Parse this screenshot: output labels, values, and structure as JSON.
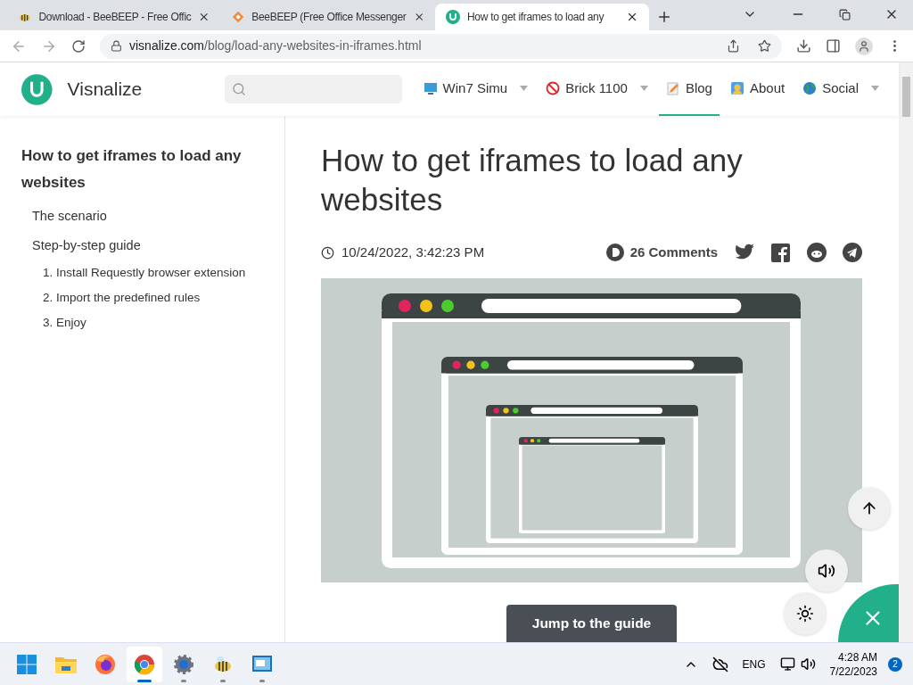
{
  "browser": {
    "tabs": [
      {
        "title": "Download - BeeBEEP - Free Offic",
        "selected": false
      },
      {
        "title": "BeeBEEP (Free Office Messenger",
        "selected": false
      },
      {
        "title": "How to get iframes to load any",
        "selected": true
      }
    ],
    "url_host": "visnalize.com",
    "url_path": "/blog/load-any-websites-in-iframes.html"
  },
  "site": {
    "logo_text": "Visnalize",
    "menu": [
      {
        "label": "Win7 Simu",
        "has_dropdown": true,
        "selected": false
      },
      {
        "label": "Brick 1100",
        "has_dropdown": true,
        "selected": false
      },
      {
        "label": "Blog",
        "has_dropdown": false,
        "selected": true
      },
      {
        "label": "About",
        "has_dropdown": false,
        "selected": false
      },
      {
        "label": "Social",
        "has_dropdown": true,
        "selected": false
      }
    ]
  },
  "toc": {
    "title": "How to get iframes to load any websites",
    "items": [
      {
        "label": "The scenario"
      },
      {
        "label": "Step-by-step guide",
        "children": [
          {
            "label": "1. Install Requestly browser extension"
          },
          {
            "label": "2. Import the predefined rules"
          },
          {
            "label": "3. Enjoy"
          }
        ]
      }
    ]
  },
  "article": {
    "title": "How to get iframes to load any websites",
    "date": "10/24/2022, 3:42:23 PM",
    "comments": "26 Comments",
    "jump_button": "Jump to the guide"
  },
  "taskbar": {
    "apps": [
      {
        "kind": "start",
        "selected": false,
        "running": false
      },
      {
        "kind": "files",
        "selected": false,
        "running": false
      },
      {
        "kind": "firefox",
        "selected": false,
        "running": false
      },
      {
        "kind": "chrome",
        "selected": true,
        "running": true
      },
      {
        "kind": "settings",
        "selected": false,
        "running": true
      },
      {
        "kind": "bee",
        "selected": false,
        "running": true
      },
      {
        "kind": "window",
        "selected": false,
        "running": true
      }
    ],
    "language": "ENG",
    "time": "4:28 AM",
    "date": "7/22/2023",
    "notifications": "2"
  }
}
